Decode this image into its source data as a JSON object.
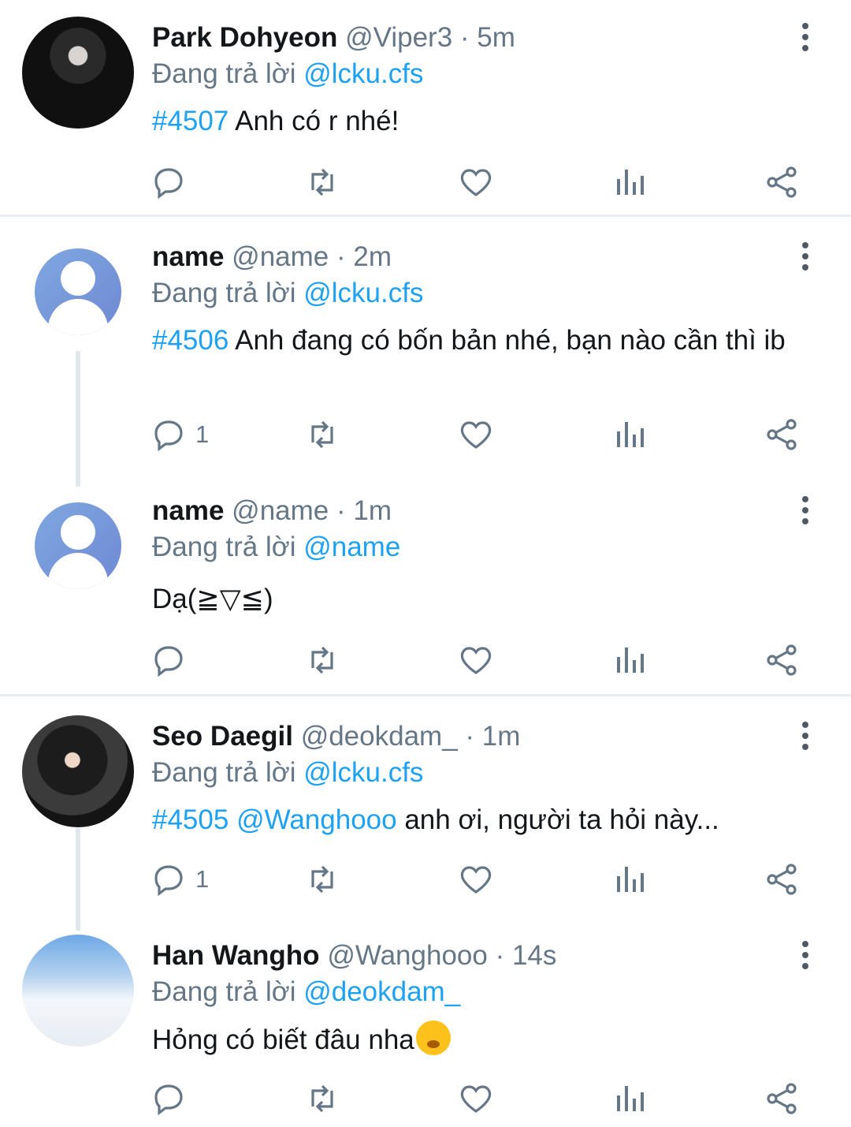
{
  "tweets": [
    {
      "name": "Park Dohyeon",
      "handle": "@Viper3",
      "sep": "·",
      "time": "5m",
      "reply_prefix": "Đang trả lời",
      "reply_to": "@lcku.cfs",
      "tag": "#4507",
      "mention": "",
      "text": "Anh có r nhé!",
      "reply_count": ""
    },
    {
      "name": "name",
      "handle": "@name",
      "sep": "·",
      "time": "2m",
      "reply_prefix": "Đang trả lời",
      "reply_to": "@lcku.cfs",
      "tag": "#4506",
      "mention": "",
      "text": "Anh đang có bốn bản nhé, bạn nào cần thì ib",
      "reply_count": "1"
    },
    {
      "name": "name",
      "handle": "@name",
      "sep": "·",
      "time": "1m",
      "reply_prefix": "Đang trả lời",
      "reply_to": "@name",
      "tag": "",
      "mention": "",
      "text": "Dạ(≧▽≦)",
      "reply_count": ""
    },
    {
      "name": "Seo Daegil",
      "handle": "@deokdam_",
      "sep": "·",
      "time": "1m",
      "reply_prefix": "Đang trả lời",
      "reply_to": "@lcku.cfs",
      "tag": "#4505",
      "mention": "@Wanghooo",
      "text": "anh ơi, người ta hỏi này...",
      "reply_count": "1"
    },
    {
      "name": "Han Wangho",
      "handle": "@Wanghooo",
      "sep": "·",
      "time": "14s",
      "reply_prefix": "Đang trả lời",
      "reply_to": "@deokdam_",
      "tag": "",
      "mention": "",
      "text": "Hỏng có biết đâu nha",
      "reply_count": ""
    }
  ],
  "icons": {
    "reply": "reply-icon",
    "retweet": "retweet-icon",
    "like": "heart-icon",
    "stats": "stats-icon",
    "share": "share-icon",
    "more": "more-vertical-icon",
    "emoji": "see-no-evil-face-emoji"
  },
  "colors": {
    "mention": "#1da1f2",
    "muted": "#657786",
    "icon": "#657786",
    "divider": "#e6ecf0"
  }
}
